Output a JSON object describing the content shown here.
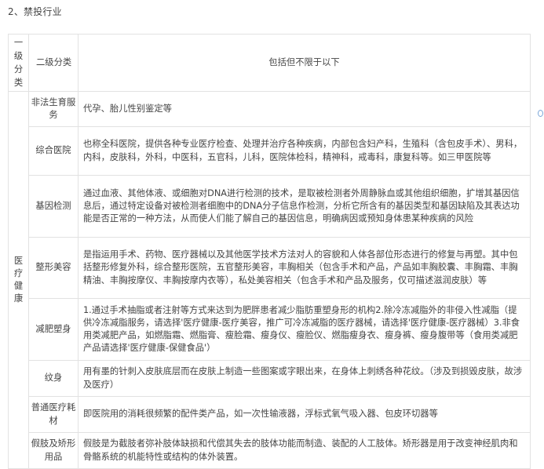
{
  "section_title": "2、禁投行业",
  "table": {
    "headers": {
      "level1": "一级分类",
      "level2": "二级分类",
      "description": "包括但不限于以下"
    },
    "category": "医疗健康",
    "rows": [
      {
        "subcategory": "非法生育服务",
        "description": "代孕、胎儿性别鉴定等"
      },
      {
        "subcategory": "综合医院",
        "description": "也称全科医院，提供各种专业医疗检查、处理并治疗各种疾病，内部包含妇产科，生殖科（含包皮手术）、男科，内科，皮肤科，外科，中医科，五官科，儿科，医院体检科，精神科，戒毒科，康复科等。如三甲医院等"
      },
      {
        "subcategory": "基因检测",
        "description": "通过血液、其他体液、或细胞对DNA进行检测的技术，是取被检测者外周静脉血或其他组织细胞，扩增其基因信息后，通过特定设备对被检测者细胞中的DNA分子信息作检测，分析它所含有的基因类型和基因缺陷及其表达功能是否正常的一种方法，从而使人们能了解自己的基因信息，明确病因或预知身体患某种疾病的风险"
      },
      {
        "subcategory": "整形美容",
        "description": "是指运用手术、药物、医疗器械以及其他医学技术方法对人的容貌和人体各部位形态进行的修复与再塑。其中包括整形修复外科，综合整形医院，五官整形美容，丰胸相关（包含手术和产品，产品如丰胸胶囊、丰胸霜、丰胸精油、丰胸按摩仪、丰胸按摩内衣等），私处美容相关（包含手术和产品及服务，仅可描述滋润皮肤）等"
      },
      {
        "subcategory": "减肥塑身",
        "description": "1.通过手术抽脂或者注射等方式来达到为肥胖患者减少脂肪重塑身形的机构2.除冷冻减脂外的非侵入性减脂（提供冷冻减脂服务，请选择'医疗健康-医疗美容，推广可冷冻减脂的医疗器械，请选择'医疗健康-医疗器械）3.非食用类减肥产品，如燃脂霜、燃脂膏、瘦脸霜、瘦身仪、瘦脸仪、燃脂瘦身衣、瘦身裤、瘦身腹带等（食用类减肥产品请选择'医疗健康-保健食品'）"
      },
      {
        "subcategory": "纹身",
        "description": "用有墨的针刺入皮肤底层而在皮肤上制造一些图案或字眼出来，在身体上刺绣各种花纹。（涉及到损毁皮肤，故涉及医疗）"
      },
      {
        "subcategory": "普通医疗耗材",
        "description": "即医院用的消耗很频繁的配件类产品，如一次性输液器，浮标式氧气吸入器、包皮环切器等"
      },
      {
        "subcategory": "假肢及矫形用品",
        "description": "假肢是为截肢者弥补肢体缺损和代偿其失去的肢体功能而制造、装配的人工肢体。矫形器是用于改变神经肌肉和骨骼系统的机能特性或结构的体外装置。"
      }
    ]
  }
}
